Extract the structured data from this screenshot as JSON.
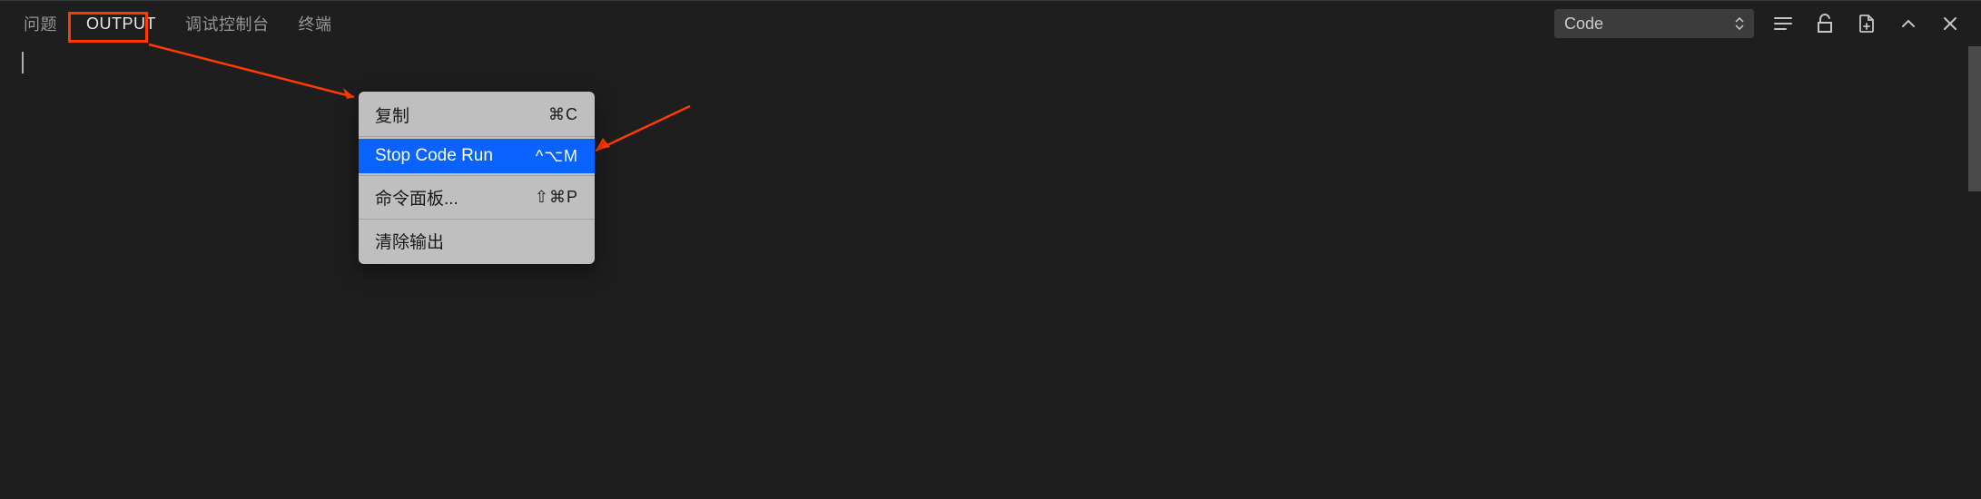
{
  "tabs": {
    "problems": "问题",
    "output": "OUTPUT",
    "debug_console": "调试控制台",
    "terminal": "终端"
  },
  "dropdown": {
    "selected": "Code"
  },
  "context_menu": {
    "copy": {
      "label": "复制",
      "shortcut": "⌘C"
    },
    "stop_code_run": {
      "label": "Stop Code Run",
      "shortcut": "^⌥M"
    },
    "command_palette": {
      "label": "命令面板...",
      "shortcut": "⇧⌘P"
    },
    "clear_output": {
      "label": "清除输出",
      "shortcut": ""
    }
  },
  "annotations": {
    "highlight_color": "#ff3b00"
  }
}
